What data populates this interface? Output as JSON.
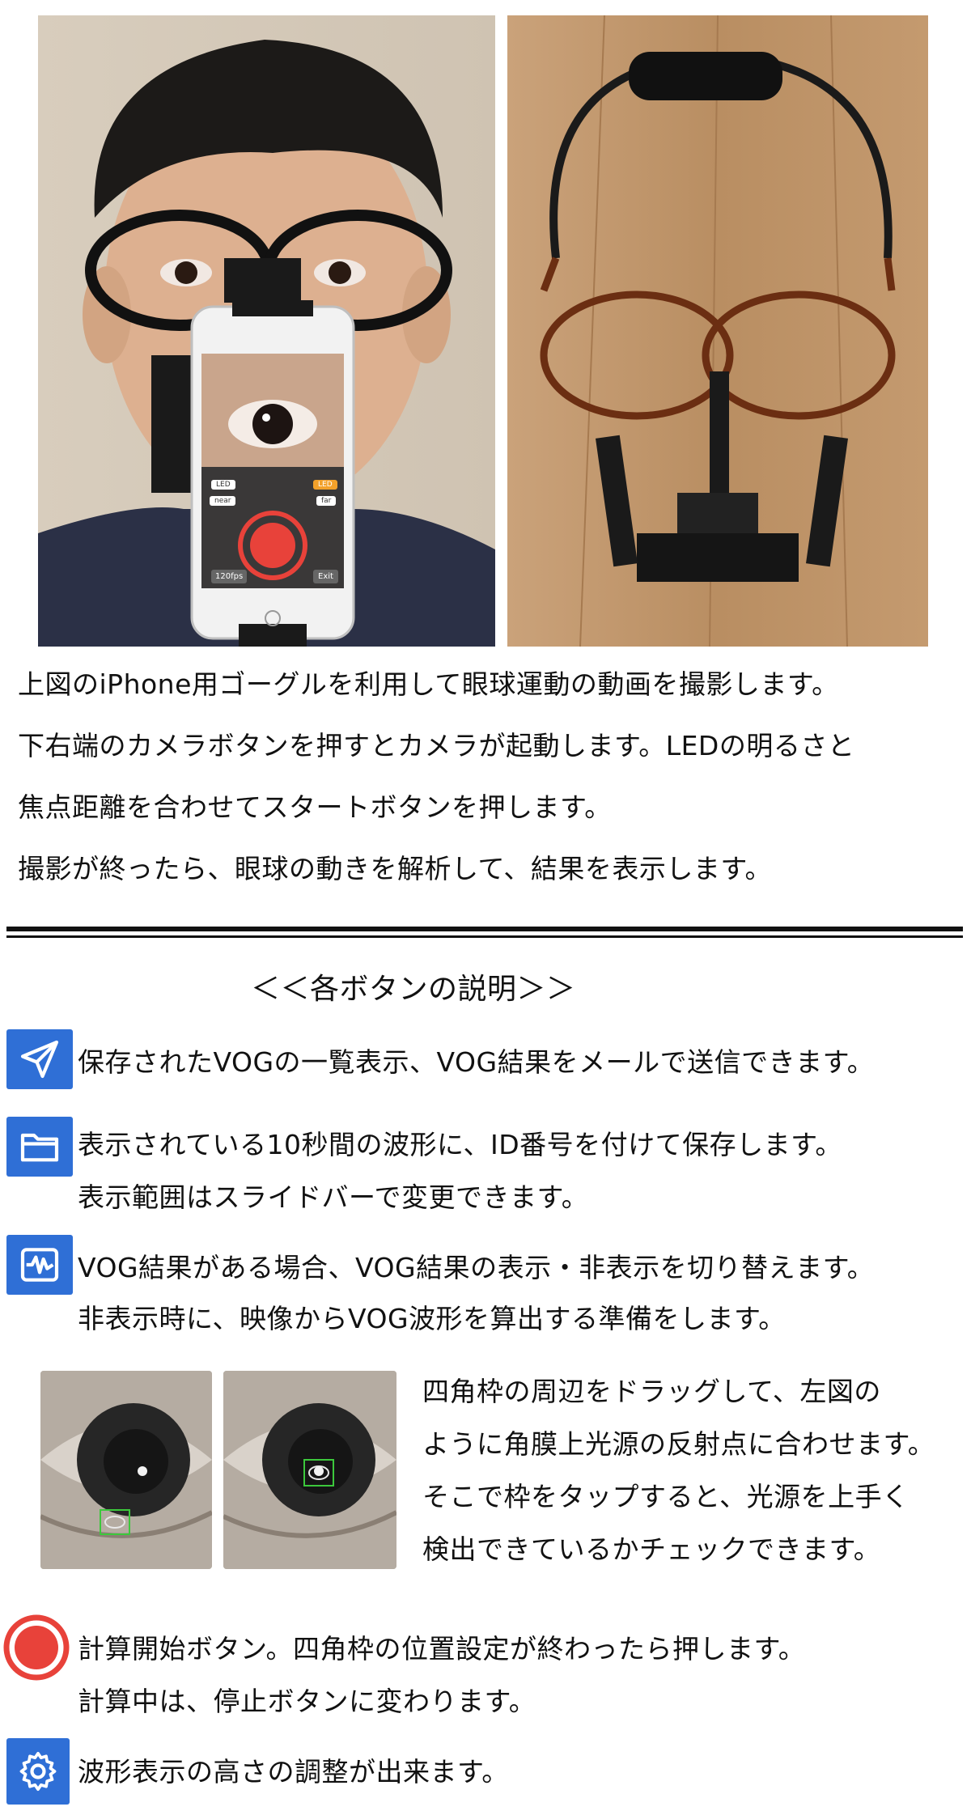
{
  "photo_left": {
    "phone_labels": {
      "led_left": "LED",
      "led_right": "LED",
      "near": "near",
      "far": "far",
      "fps": "120fps",
      "exit": "Exit"
    }
  },
  "intro": {
    "line1": "上図のiPhone用ゴーグルを利用して眼球運動の動画を撮影します。",
    "line2": "下右端のカメラボタンを押すとカメラが起動します。LEDの明るさと",
    "line3": "焦点距離を合わせてスタートボタンを押します。",
    "line4": "撮影が終ったら、眼球の動きを解析して、結果を表示します。"
  },
  "section": {
    "title": "＜＜各ボタンの説明＞＞"
  },
  "buttons": {
    "send": {
      "icon": "paper-plane-icon",
      "line1": "保存されたVOGの一覧表示、VOG結果をメールで送信できます。"
    },
    "folder": {
      "icon": "folder-icon",
      "line1": "表示されている10秒間の波形に、ID番号を付けて保存します。",
      "line2": "表示範囲はスライドバーで変更できます。"
    },
    "wave": {
      "icon": "waveform-icon",
      "line1": "VOG結果がある場合、VOG結果の表示・非表示を切り替えます。",
      "line2": "非表示時に、映像からVOG波形を算出する準備をします。"
    },
    "eye_explain": {
      "line1": "四角枠の周辺をドラッグして、左図の",
      "line2": "ように角膜上光源の反射点に合わせます。",
      "line3": "そこで枠をタップすると、光源を上手く",
      "line4": "検出できているかチェックできます。"
    },
    "record": {
      "icon": "record-circle-icon",
      "line1": "計算開始ボタン。四角枠の位置設定が終わったら押します。",
      "line2": "計算中は、停止ボタンに変わります。"
    },
    "gear": {
      "icon": "gear-icon",
      "line1": "波形表示の高さの調整が出来ます。"
    }
  },
  "colors": {
    "icon_blue": "#2f6fd6",
    "record_red": "#e8423a",
    "box_green": "#3cc83c"
  }
}
